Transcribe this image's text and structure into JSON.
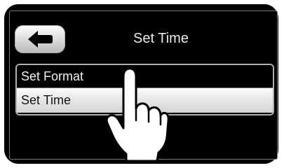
{
  "header": {
    "title": "Set Time",
    "back_icon": "left-arrow-icon"
  },
  "menu": {
    "items": [
      {
        "label": "Set Format",
        "selected": false
      },
      {
        "label": "Set Time",
        "selected": true
      }
    ]
  },
  "overlay": {
    "pointer_icon": "pointing-hand-icon"
  },
  "colors": {
    "background": "#000000",
    "text": "#e9e9e9",
    "selected_row": "#e6e6e6"
  }
}
